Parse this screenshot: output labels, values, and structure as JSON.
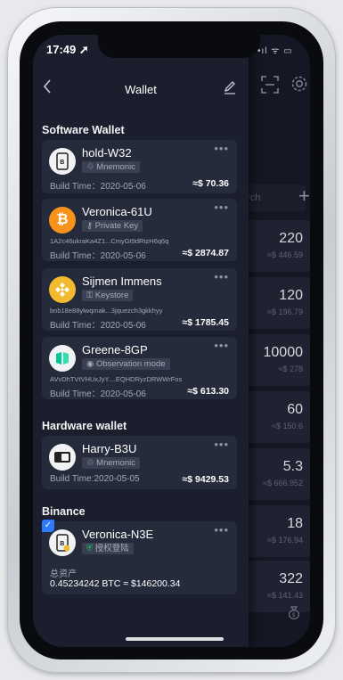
{
  "status_bar": {
    "time": "17:49 ➚",
    "right_icons": "•ıl ᯤ ▭"
  },
  "nav": {
    "title": "Wallet",
    "back_icon": "chevron-left-icon",
    "edit_icon": "edit-pencil-icon"
  },
  "sections": {
    "software": "Software Wallet",
    "hardware": "Hardware wallet",
    "binance": "Binance"
  },
  "wallets": [
    {
      "name": "hold-W32",
      "tag": "Mnemonic",
      "tag_icon": "shield-icon",
      "address": "",
      "build": "Build Time：2020-05-06",
      "usd": "≈$ 70.36",
      "avatar": "phone-b-icon"
    },
    {
      "name": "Veronica-61U",
      "tag": "Private Key",
      "tag_icon": "key-icon",
      "address": "1A2c46ukraKa4Z1...CmyGt9dRtzH6q6q",
      "build": "Build Time：2020-05-06",
      "usd": "≈$ 2874.87",
      "avatar": "bitcoin-icon"
    },
    {
      "name": "Sijmen Immens",
      "tag": "Keystore",
      "tag_icon": "keystore-icon",
      "address": "bnb18e88ylwqmak...3jquezch3gkkhyy",
      "build": "Build Time：2020-05-06",
      "usd": "≈$ 1785.45",
      "avatar": "binance-icon"
    },
    {
      "name": "Greene-8GP",
      "tag": "Observation mode",
      "tag_icon": "eye-icon",
      "address": "AVvDhTVtVHUxJyY....EQHDRyzDRWWrFos",
      "build": "Build Time：2020-05-06",
      "usd": "≈$ 613.30",
      "avatar": "neo-icon"
    },
    {
      "name": "Harry-B3U",
      "tag": "Mnemonic",
      "tag_icon": "shield-icon",
      "address": "",
      "build": "Build Time:2020-05-05",
      "usd": "≈$ 9429.53",
      "avatar": "hardware-device-icon"
    }
  ],
  "binance_wallet": {
    "name": "Veronica-N3E",
    "tag": "授权登陆",
    "total_label": "总资产",
    "total_value": "0.45234242 BTC ≈ $146200.34",
    "checkmark": "✓"
  },
  "background": {
    "search_placeholder": "arch",
    "rows": [
      {
        "amount": "220",
        "usd": "≈$ 446.59"
      },
      {
        "amount": "120",
        "usd": "≈$ 196.79"
      },
      {
        "amount": "10000",
        "usd": "≈$ 278"
      },
      {
        "amount": "60",
        "usd": "≈$ 150.6"
      },
      {
        "amount": "5.3",
        "usd": "≈$ 666.952"
      },
      {
        "amount": "18",
        "usd": "≈$ 176.94"
      },
      {
        "amount": "322",
        "usd": "≈$ 141.43"
      }
    ]
  },
  "colors": {
    "drawer": "#1b1f2d",
    "card": "#262b3b",
    "accent": "#2b7cff"
  }
}
